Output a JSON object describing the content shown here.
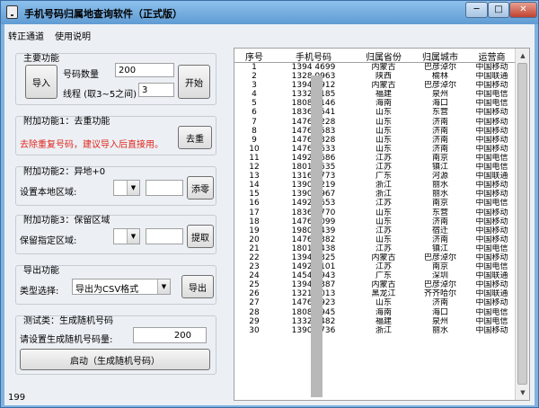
{
  "window": {
    "title": "手机号码归属地查询软件（正式版）",
    "min_label": "─",
    "max_label": "□",
    "close_label": "✕"
  },
  "menu": [
    "转正通道",
    "使用说明"
  ],
  "main": {
    "title": "主要功能",
    "import_label": "导入",
    "count_label": "号码数量",
    "count_value": "200",
    "thread_label": "线程 (取3~5之间)",
    "thread_value": "3",
    "start_label": "开始"
  },
  "addon1": {
    "title": "附加功能1：去重功能",
    "hint": "去除重复号码，建议导入后直接用。",
    "button": "去重"
  },
  "addon2": {
    "title": "附加功能2：异地+0",
    "label": "设置本地区域:",
    "select_value": "",
    "input_value": "",
    "button": "添零"
  },
  "addon3": {
    "title": "附加功能3：保留区域",
    "label": "保留指定区域:",
    "select_value": "",
    "input_value": "",
    "button": "提取"
  },
  "export": {
    "title": "导出功能",
    "type_label": "类型选择:",
    "type_value": "导出为CSV格式",
    "button": "导出"
  },
  "test": {
    "title": "测试类：生成随机号码",
    "label": "请设置生成随机号码量:",
    "value": "200",
    "button": "启动（生成随机号码）"
  },
  "table": {
    "columns": [
      "序号",
      "手机号码",
      "归属省份",
      "归属城市",
      "运营商"
    ],
    "rows": [
      [
        "1",
        "1394 4699",
        "内蒙古",
        "巴彦淖尔",
        "中国移动"
      ],
      [
        "2",
        "1328 0963",
        "陕西",
        "榆林",
        "中国联通"
      ],
      [
        "3",
        "1394 1912",
        "内蒙古",
        "巴彦淖尔",
        "中国移动"
      ],
      [
        "4",
        "1332 5185",
        "福建",
        "泉州",
        "中国电信"
      ],
      [
        "5",
        "1808 7146",
        "海南",
        "海口",
        "中国电信"
      ],
      [
        "6",
        "1836 6541",
        "山东",
        "东营",
        "中国移动"
      ],
      [
        "7",
        "1476 5228",
        "山东",
        "济南",
        "中国移动"
      ],
      [
        "8",
        "1476 5583",
        "山东",
        "济南",
        "中国移动"
      ],
      [
        "9",
        "1476 5328",
        "山东",
        "济南",
        "中国移动"
      ],
      [
        "10",
        "1476 5633",
        "山东",
        "济南",
        "中国移动"
      ],
      [
        "11",
        "1492 3686",
        "江苏",
        "南京",
        "中国电信"
      ],
      [
        "12",
        "1801 0535",
        "江苏",
        "镇江",
        "中国电信"
      ],
      [
        "13",
        "1316 3773",
        "广东",
        "河源",
        "中国联通"
      ],
      [
        "14",
        "1390 3219",
        "浙江",
        "丽水",
        "中国移动"
      ],
      [
        "15",
        "1390 3967",
        "浙江",
        "丽水",
        "中国移动"
      ],
      [
        "16",
        "1492 3653",
        "江苏",
        "南京",
        "中国电信"
      ],
      [
        "17",
        "1836 0770",
        "山东",
        "东营",
        "中国移动"
      ],
      [
        "18",
        "1476 5099",
        "山东",
        "济南",
        "中国移动"
      ],
      [
        "19",
        "1980 5439",
        "江苏",
        "宿迁",
        "中国移动"
      ],
      [
        "20",
        "1476 5382",
        "山东",
        "济南",
        "中国移动"
      ],
      [
        "21",
        "1801 4438",
        "江苏",
        "镇江",
        "中国电信"
      ],
      [
        "22",
        "1394 9325",
        "内蒙古",
        "巴彦淖尔",
        "中国移动"
      ],
      [
        "23",
        "1492 1101",
        "江苏",
        "南京",
        "中国电信"
      ],
      [
        "24",
        "1454 1943",
        "广东",
        "深圳",
        "中国联通"
      ],
      [
        "25",
        "1394 1387",
        "内蒙古",
        "巴彦淖尔",
        "中国移动"
      ],
      [
        "26",
        "1321 2013",
        "黑龙江",
        "齐齐哈尔",
        "中国联通"
      ],
      [
        "27",
        "1476 5923",
        "山东",
        "济南",
        "中国移动"
      ],
      [
        "28",
        "1808 7945",
        "海南",
        "海口",
        "中国电信"
      ],
      [
        "29",
        "1332 5482",
        "福建",
        "泉州",
        "中国电信"
      ],
      [
        "30",
        "1390 9736",
        "浙江",
        "丽水",
        "中国移动"
      ]
    ]
  },
  "status_text": "199"
}
